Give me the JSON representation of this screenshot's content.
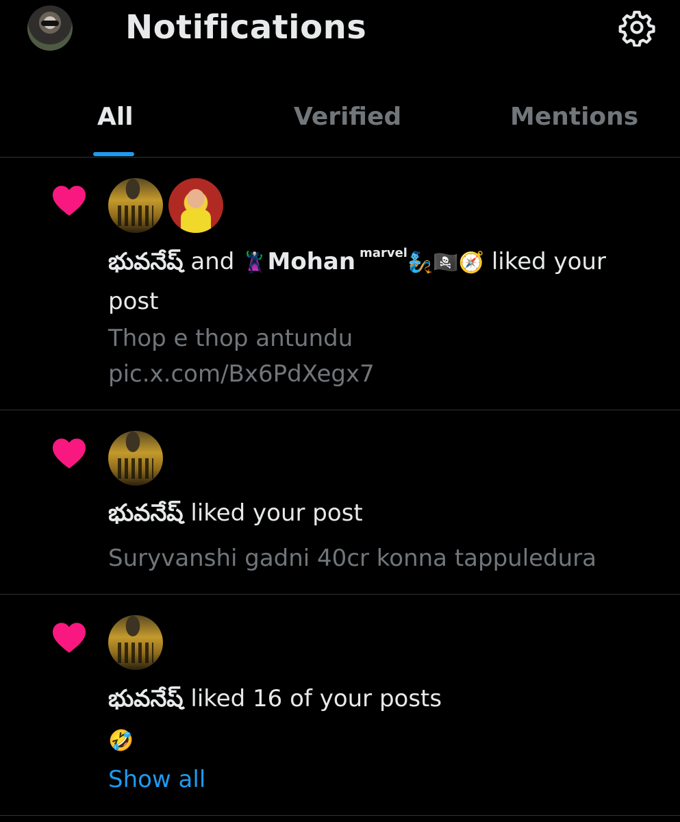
{
  "header": {
    "title": "Notifications",
    "avatar_icon": "profile-avatar",
    "settings_icon": "gear-icon"
  },
  "tabs": [
    {
      "label": "All",
      "active": true
    },
    {
      "label": "Verified",
      "active": false
    },
    {
      "label": "Mentions",
      "active": false
    }
  ],
  "colors": {
    "background": "#000000",
    "text": "#e7e9ea",
    "muted": "#71767b",
    "accent": "#1d9bf0",
    "like": "#f91880",
    "divider": "#2f3336"
  },
  "notifications": [
    {
      "icon": "heart-icon",
      "actor1": "భువనేష్",
      "connector": "and",
      "actor2_prefix": "🦹",
      "actor2": "Mohan",
      "actor2_super": "marvel",
      "actor2_suffix": "🧞🏴‍☠️🧭",
      "action": "liked your",
      "action_cont": "post",
      "post_line1": "Thop e thop antundu",
      "post_line2": "pic.x.com/Bx6PdXegx7"
    },
    {
      "icon": "heart-icon",
      "actor1": "భువనేష్",
      "action": "liked your post",
      "post_line1": "Suryvanshi gadni 40cr konna tappuledura"
    },
    {
      "icon": "heart-icon",
      "actor1": "భువనేష్",
      "action": "liked 16 of your posts",
      "post_line1": "🤣",
      "show_all": "Show all"
    }
  ]
}
